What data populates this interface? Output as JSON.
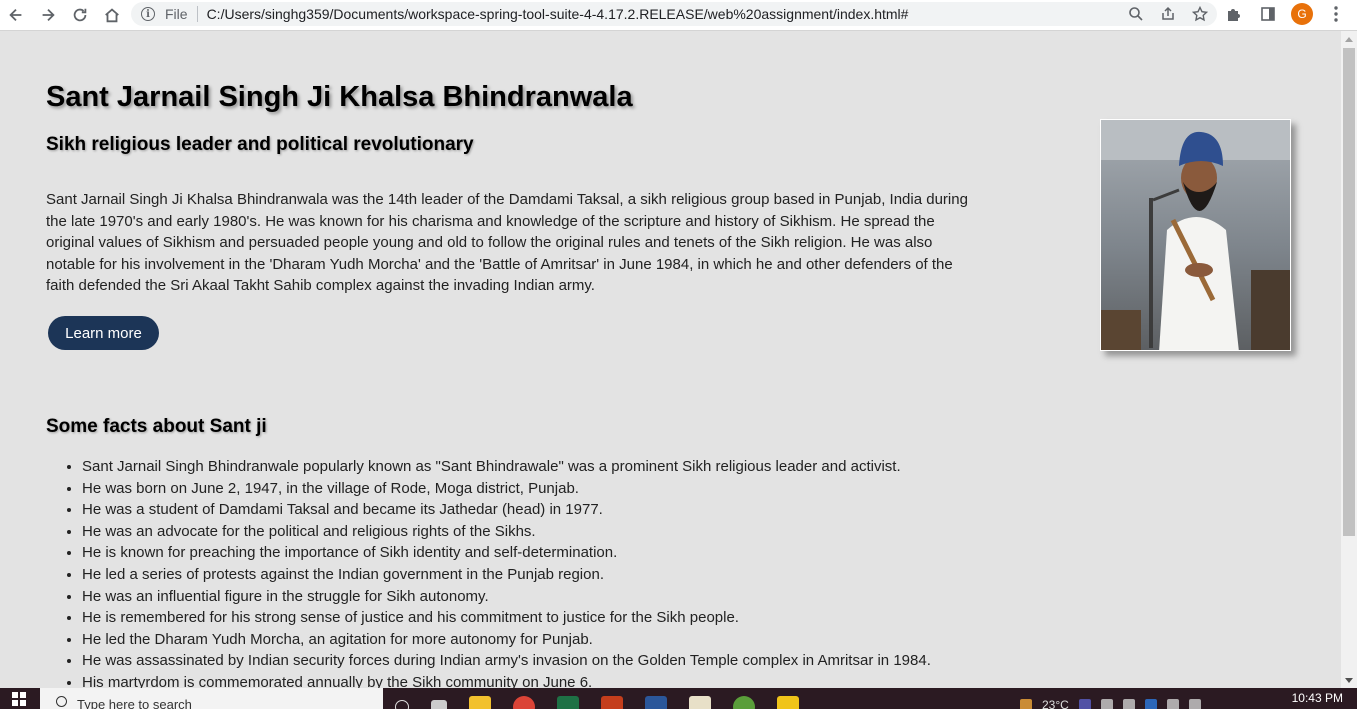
{
  "browser": {
    "scheme": "File",
    "url": "C:/Users/singhg359/Documents/workspace-spring-tool-suite-4-4.17.2.RELEASE/web%20assignment/index.html#",
    "avatar_letter": "G"
  },
  "page": {
    "title": "Sant Jarnail Singh Ji Khalsa Bhindranwala",
    "subtitle": "Sikh religious leader and political revolutionary",
    "intro": "Sant Jarnail Singh Ji Khalsa Bhindranwala was the 14th leader of the Damdami Taksal, a sikh religious group based in Punjab, India during the late 1970's and early 1980's. He was known for his charisma and knowledge of the scripture and history of Sikhism. He spread the original values of Sikhism and persuaded people young and old to follow the original rules and tenets of the Sikh religion. He was also notable for his involvement in the 'Dharam Yudh Morcha' and the 'Battle of Amritsar' in June 1984, in which he and other defenders of the faith defended the Sri Akaal Takht Sahib complex against the invading Indian army.",
    "learn_more_label": "Learn more",
    "facts_heading": "Some facts about Sant ji",
    "facts": [
      "Sant Jarnail Singh Bhindranwale popularly known as \"Sant Bhindrawale\" was a prominent Sikh religious leader and activist.",
      "He was born on June 2, 1947, in the village of Rode, Moga district, Punjab.",
      "He was a student of Damdami Taksal and became its Jathedar (head) in 1977.",
      "He was an advocate for the political and religious rights of the Sikhs.",
      "He is known for preaching the importance of Sikh identity and self-determination.",
      "He led a series of protests against the Indian government in the Punjab region.",
      "He was an influential figure in the struggle for Sikh autonomy.",
      "He is remembered for his strong sense of justice and his commitment to justice for the Sikh people.",
      "He led the Dharam Yudh Morcha, an agitation for more autonomy for Punjab.",
      "He was assassinated by Indian security forces during Indian army's invasion on the Golden Temple complex in Amritsar in 1984.",
      "His martyrdom is commemorated annually by the Sikh community on June 6."
    ]
  },
  "taskbar": {
    "search_placeholder": "Type here to search",
    "temperature": "23°C",
    "time": "10:43 PM"
  },
  "colors": {
    "page_bg": "#e3e3e3",
    "button_bg": "#1c3557",
    "taskbar_bg": "#2b1a22",
    "avatar_bg": "#e8710a"
  }
}
